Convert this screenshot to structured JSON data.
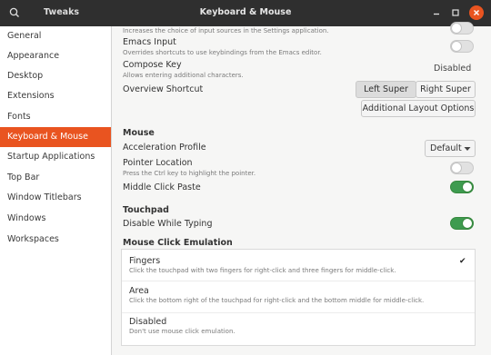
{
  "header": {
    "app_title": "Tweaks",
    "window_title": "Keyboard & Mouse"
  },
  "sidebar": {
    "items": [
      {
        "label": "General"
      },
      {
        "label": "Appearance"
      },
      {
        "label": "Desktop"
      },
      {
        "label": "Extensions"
      },
      {
        "label": "Fonts"
      },
      {
        "label": "Keyboard & Mouse"
      },
      {
        "label": "Startup Applications"
      },
      {
        "label": "Top Bar"
      },
      {
        "label": "Window Titlebars"
      },
      {
        "label": "Windows"
      },
      {
        "label": "Workspaces"
      }
    ],
    "active_index": 5
  },
  "keyboard": {
    "input_sources_desc": "Increases the choice of input sources in the Settings application.",
    "emacs_label": "Emacs Input",
    "emacs_desc": "Overrides shortcuts to use keybindings from the Emacs editor.",
    "emacs_on": false,
    "compose_label": "Compose Key",
    "compose_desc": "Allows entering additional characters.",
    "compose_value": "Disabled",
    "overview_label": "Overview Shortcut",
    "overview_left": "Left Super",
    "overview_right": "Right Super",
    "additional_layout": "Additional Layout Options"
  },
  "mouse": {
    "section": "Mouse",
    "accel_label": "Acceleration Profile",
    "accel_value": "Default",
    "pointer_label": "Pointer Location",
    "pointer_desc": "Press the Ctrl key to highlight the pointer.",
    "pointer_on": false,
    "middle_label": "Middle Click Paste",
    "middle_on": true
  },
  "touchpad": {
    "section": "Touchpad",
    "dwt_label": "Disable While Typing",
    "dwt_on": true
  },
  "emulation": {
    "section": "Mouse Click Emulation",
    "options": [
      {
        "title": "Fingers",
        "desc": "Click the touchpad with two fingers for right-click and three fingers for middle-click.",
        "selected": true
      },
      {
        "title": "Area",
        "desc": "Click the bottom right of the touchpad for right-click and the bottom middle for middle-click.",
        "selected": false
      },
      {
        "title": "Disabled",
        "desc": "Don't use mouse click emulation.",
        "selected": false
      }
    ],
    "check_glyph": "✔"
  },
  "colors": {
    "accent": "#e95420",
    "switch_on": "#3e9b4f",
    "header_bg": "#2f2f2f"
  },
  "icons": {
    "search": "search-icon",
    "minimize": "minimize-icon",
    "maximize": "maximize-icon",
    "close": "close-icon",
    "dropdown": "chevron-down-icon",
    "check": "checkmark-icon"
  }
}
